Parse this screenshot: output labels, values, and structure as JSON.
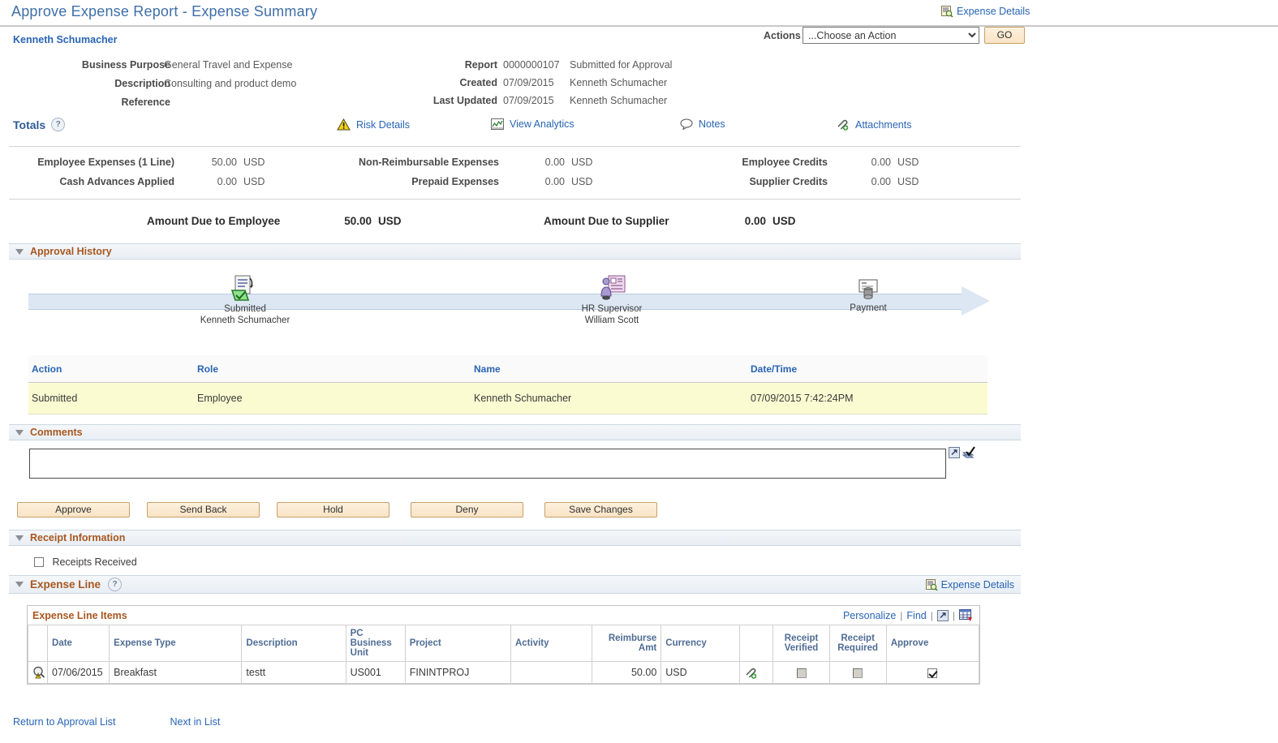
{
  "header": {
    "page_title": "Approve Expense Report - Expense Summary",
    "expense_details_link": "Expense Details",
    "employee_name": "Kenneth Schumacher",
    "actions_label": "Actions",
    "actions_selected": "...Choose an Action",
    "actions_options": [
      "...Choose an Action"
    ],
    "go_label": "GO"
  },
  "info": {
    "left": [
      {
        "label": "Business Purpose",
        "value": "General Travel and Expense"
      },
      {
        "label": "Description",
        "value": "Consulting and product demo"
      },
      {
        "label": "Reference",
        "value": ""
      }
    ],
    "right": [
      {
        "label": "Report",
        "value": "0000000107",
        "extra": "Submitted for Approval"
      },
      {
        "label": "Created",
        "value": "07/09/2015",
        "extra": "Kenneth Schumacher"
      },
      {
        "label": "Last Updated",
        "value": "07/09/2015",
        "extra": "Kenneth Schumacher"
      }
    ]
  },
  "totals": {
    "title": "Totals",
    "help": "?",
    "links": [
      {
        "label": "Risk Details",
        "icon": "warning-triangle-icon"
      },
      {
        "label": "View Analytics",
        "icon": "analytics-chart-icon"
      },
      {
        "label": "Notes",
        "icon": "speech-bubble-icon"
      },
      {
        "label": "Attachments",
        "icon": "paperclip-add-icon"
      }
    ],
    "rows": [
      {
        "label": "Employee Expenses (1 Line)",
        "amount": "50.00",
        "currency": "USD"
      },
      {
        "label": "Cash Advances Applied",
        "amount": "0.00",
        "currency": "USD"
      },
      {
        "label": "Non-Reimbursable Expenses",
        "amount": "0.00",
        "currency": "USD"
      },
      {
        "label": "Prepaid Expenses",
        "amount": "0.00",
        "currency": "USD"
      },
      {
        "label": "Employee Credits",
        "amount": "0.00",
        "currency": "USD"
      },
      {
        "label": "Supplier Credits",
        "amount": "0.00",
        "currency": "USD"
      }
    ],
    "due_employee_label": "Amount Due to Employee",
    "due_employee_amount": "50.00",
    "due_employee_currency": "USD",
    "due_supplier_label": "Amount Due to Supplier",
    "due_supplier_amount": "0.00",
    "due_supplier_currency": "USD"
  },
  "approval_history": {
    "section_title": "Approval History",
    "stages": [
      {
        "title": "Submitted",
        "person": "Kenneth Schumacher",
        "icon": "submitted-document-icon"
      },
      {
        "title": "HR Supervisor",
        "person": "William Scott",
        "icon": "approver-person-icon"
      },
      {
        "title": "Payment",
        "person": "",
        "icon": "payment-icon"
      }
    ],
    "columns": [
      "Action",
      "Role",
      "Name",
      "Date/Time"
    ],
    "rows": [
      {
        "action": "Submitted",
        "role": "Employee",
        "name": "Kenneth Schumacher",
        "datetime": "07/09/2015  7:42:24PM"
      }
    ]
  },
  "comments": {
    "section_title": "Comments",
    "value": "",
    "expand_icon": "expand-popup-icon",
    "spellcheck_icon": "spellcheck-icon",
    "buttons": [
      "Approve",
      "Send Back",
      "Hold",
      "Deny",
      "Save Changes"
    ]
  },
  "receipt_information": {
    "section_title": "Receipt Information",
    "checkbox_label": "Receipts Received",
    "checked": false
  },
  "expense_line": {
    "section_title": "Expense Line",
    "help": "?",
    "expense_details_link": "Expense Details",
    "grid_title": "Expense Line Items",
    "tools": {
      "personalize": "Personalize",
      "find": "Find",
      "separator": "|",
      "expand_icon": "expand-grid-icon",
      "download_icon": "download-spreadsheet-icon"
    },
    "columns": [
      "",
      "Date",
      "Expense Type",
      "Description",
      "PC Business Unit",
      "Project",
      "Activity",
      "Reimburse Amt",
      "Currency",
      "",
      "Receipt Verified",
      "Receipt Required",
      "Approve"
    ],
    "rows": [
      {
        "risk_icon": "expense-risk-magnifier-icon",
        "date": "07/06/2015",
        "expense_type": "Breakfast",
        "description": "testt",
        "pc_business_unit": "US001",
        "project": "FININTPROJ",
        "activity": "",
        "reimburse_amt": "50.00",
        "currency": "USD",
        "attachment_icon": "paperclip-add-icon",
        "receipt_verified": false,
        "receipt_verified_disabled": true,
        "receipt_required": false,
        "receipt_required_disabled": true,
        "approve": true
      }
    ]
  },
  "footer": {
    "return_link": "Return to Approval List",
    "next_link": "Next in List"
  }
}
